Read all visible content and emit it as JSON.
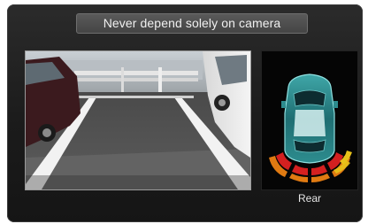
{
  "warning": {
    "text": "Never depend solely on camera"
  },
  "camera": {
    "icon": "rear-camera-feed"
  },
  "sensors": {
    "label": "Rear",
    "icon": "car-top-view-icon",
    "colors": {
      "near": "#d42020",
      "mid": "#e07a12",
      "far": "#e8c21a"
    }
  }
}
